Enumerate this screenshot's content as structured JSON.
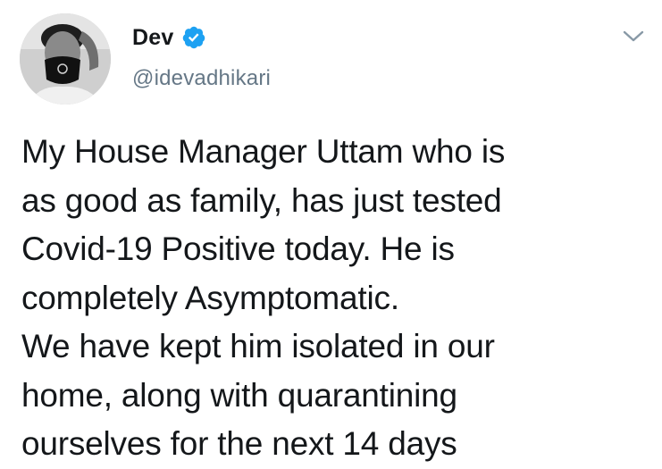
{
  "tweet": {
    "author": {
      "display_name": "Dev",
      "handle": "@idevadhikari",
      "verified_icon": "verified-badge-icon",
      "avatar_icon": "profile-photo"
    },
    "menu_icon": "chevron-down-icon",
    "text": "My House Manager Uttam who is\nas good as family, has just tested\nCovid-19 Positive today. He is\ncompletely Asymptomatic.\nWe have kept him isolated in our\nhome, along with quarantining\nourselves for the next 14 days"
  },
  "colors": {
    "verified_blue": "#1da1f2",
    "text_primary": "#14171a",
    "text_secondary": "#657786"
  }
}
